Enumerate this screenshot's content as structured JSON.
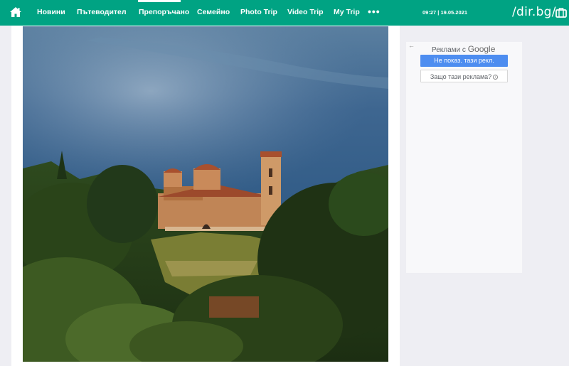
{
  "nav": {
    "home_icon": "home-icon",
    "items": [
      {
        "label": "Новини"
      },
      {
        "label": "Пътеводител"
      },
      {
        "label": "Препоръчано",
        "active": true
      },
      {
        "label": "Семейно"
      },
      {
        "label": "Photo Trip"
      },
      {
        "label": "Video Trip"
      },
      {
        "label": "My Trip"
      }
    ],
    "more_label": "•••",
    "datetime": "09:27 | 19.05.2021",
    "logo": "/dir.bg/",
    "briefcase_icon": "briefcase-icon",
    "accent_color": "#00a383"
  },
  "ad": {
    "back_label": "←",
    "title_prefix": "Реклами с",
    "title_brand": "Google",
    "hide_button": "Не показ. тази рекл.",
    "why_button": "Защо тази реклама?",
    "info_icon": "i",
    "button_color": "#4d8df0"
  }
}
